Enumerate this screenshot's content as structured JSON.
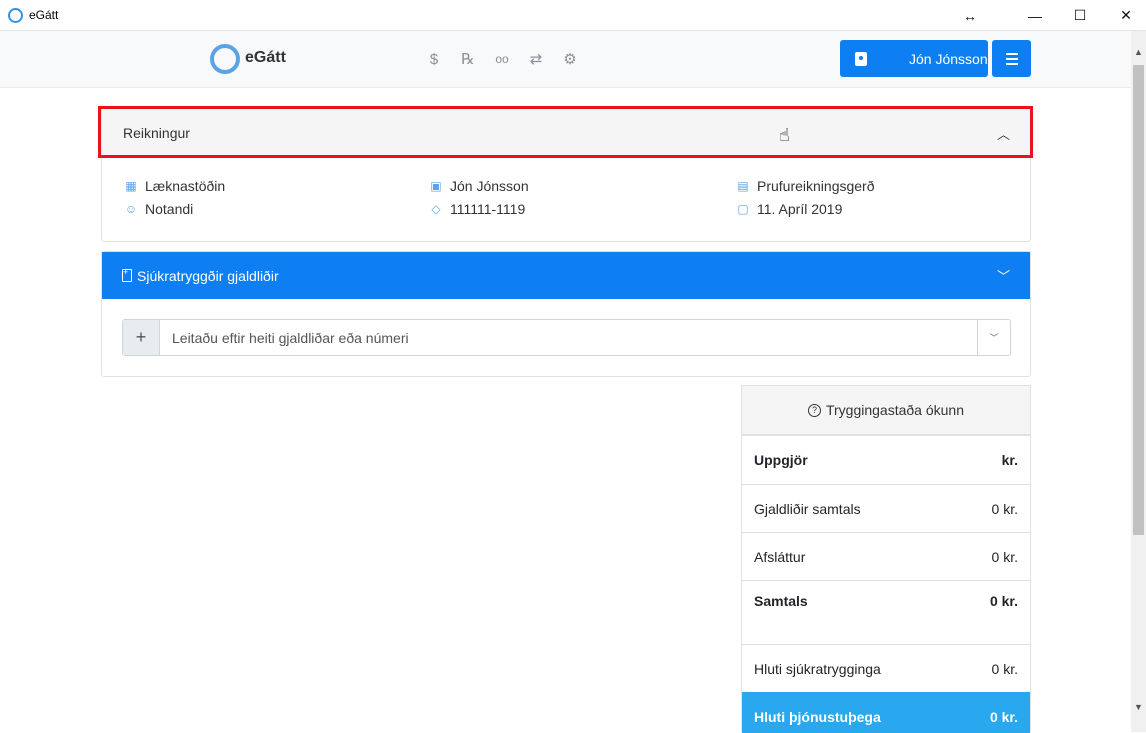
{
  "window": {
    "title": "eGátt",
    "controls": {
      "resize": "↔",
      "minimize": "—",
      "maximize": "☐",
      "close": "✕"
    }
  },
  "navbar": {
    "logo_text": "eGátt",
    "icons": [
      "dollar-icon",
      "prescription-icon",
      "glasses-icon",
      "transfer-icon",
      "gears-icon"
    ],
    "icon_glyphs": [
      "$",
      "℞",
      "oo",
      "⇄",
      "⚙"
    ],
    "user_button_label": "Jón Jónsson",
    "accent_color": "#0d7ff2"
  },
  "invoice": {
    "header_title": "Reikningur",
    "left": [
      {
        "icon": "hospital-icon",
        "text": "Læknastöðin"
      },
      {
        "icon": "user-icon",
        "text": "Notandi"
      }
    ],
    "middle": [
      {
        "icon": "id-badge-icon",
        "text": "Jón Jónsson"
      },
      {
        "icon": "tag-icon",
        "text": "111111-1119"
      }
    ],
    "right": [
      {
        "icon": "calculator-icon",
        "text": "Prufureikningsgerð"
      },
      {
        "icon": "calendar-icon",
        "text": "11. Apríl 2019"
      }
    ]
  },
  "items": {
    "header_title": "Sjúkratryggðir gjaldliðir",
    "search_placeholder": "Leitaðu eftir heiti gjaldliðar eða númeri",
    "add_label": "+"
  },
  "summary": {
    "status": "Tryggingastaða ókunn",
    "rows": [
      {
        "label": "Uppgjör",
        "value": "kr."
      },
      {
        "label": "Gjaldliðir samtals",
        "value": "0 kr."
      },
      {
        "label": "Afsláttur",
        "value": "0 kr."
      },
      {
        "label": "Samtals",
        "value": "0 kr."
      },
      {
        "label": "Hluti sjúkratrygginga",
        "value": "0 kr."
      },
      {
        "label": "Hluti þjónustuþega",
        "value": "0 kr."
      }
    ],
    "highlight_color": "#29a8ef"
  },
  "highlight_color": "#e8141c"
}
